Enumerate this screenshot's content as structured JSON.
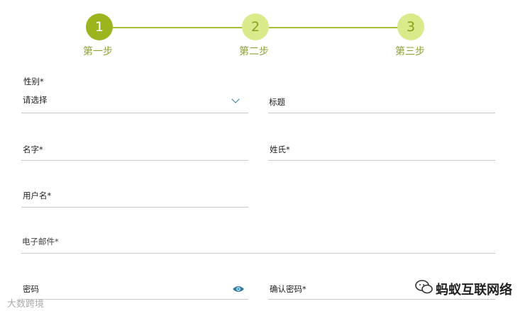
{
  "stepper": {
    "steps": [
      {
        "number": "1",
        "label": "第一步",
        "state": "active"
      },
      {
        "number": "2",
        "label": "第二步",
        "state": "inactive"
      },
      {
        "number": "3",
        "label": "第三步",
        "state": "inactive"
      }
    ],
    "colors": {
      "active": "#9cb51f",
      "inactive": "#d9ea8a",
      "line": "#a8bf35",
      "label": "#8da236"
    }
  },
  "form": {
    "gender": {
      "label": "性别*",
      "value": "请选择"
    },
    "title": {
      "label": "标题"
    },
    "first_name": {
      "label": "名字*"
    },
    "last_name": {
      "label": "姓氏*"
    },
    "username": {
      "label": "用户名*"
    },
    "email": {
      "label": "电子邮件*"
    },
    "password": {
      "label": "密码"
    },
    "confirm_password": {
      "label": "确认密码*"
    }
  },
  "icons": {
    "select": "chevron-down-icon",
    "password_toggle": "eye-icon",
    "eye_color": "#2b7fa3"
  },
  "watermark": {
    "right_text": "蚂蚁互联网络",
    "left_text": "大数跨境"
  }
}
